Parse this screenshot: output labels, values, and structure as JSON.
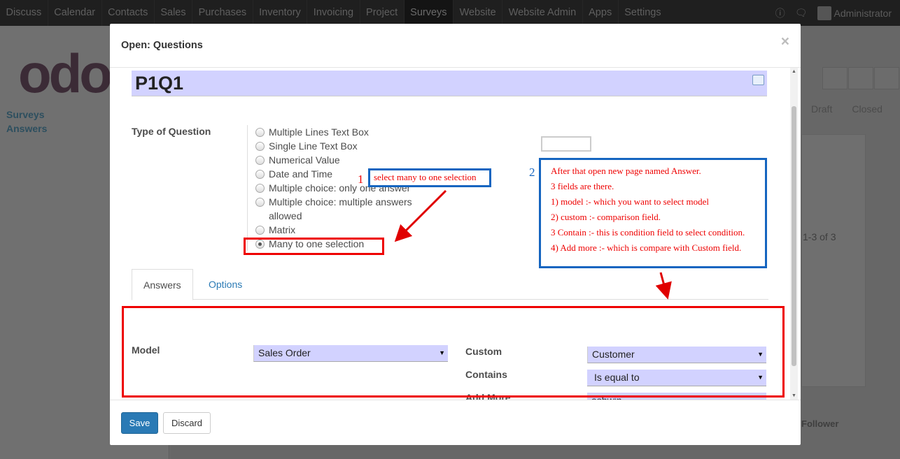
{
  "topbar": {
    "menu": [
      "Discuss",
      "Calendar",
      "Contacts",
      "Sales",
      "Purchases",
      "Inventory",
      "Invoicing",
      "Project",
      "Surveys",
      "Website",
      "Website Admin",
      "Apps",
      "Settings"
    ],
    "active": "Surveys",
    "user": "Administrator"
  },
  "background": {
    "logo": "odo",
    "sidebar_links": [
      "Surveys",
      "Answers"
    ],
    "status_steps": [
      "Draft",
      "Closed"
    ],
    "pager": "1-3 of 3",
    "follower_label": "Follower"
  },
  "modal": {
    "title": "Open: Questions",
    "close_label": "×",
    "question_name": "P1Q1",
    "type_label": "Type of Question",
    "question_types": [
      {
        "label": "Multiple Lines Text Box",
        "checked": false
      },
      {
        "label": "Single Line Text Box",
        "checked": false
      },
      {
        "label": "Numerical Value",
        "checked": false
      },
      {
        "label": "Date and Time",
        "checked": false
      },
      {
        "label": "Multiple choice: only one answer",
        "checked": false
      },
      {
        "label": "Multiple choice: multiple answers allowed",
        "checked": false
      },
      {
        "label": "Matrix",
        "checked": false
      },
      {
        "label": "Many to one selection",
        "checked": true
      }
    ],
    "tabs": [
      {
        "label": "Answers",
        "active": true
      },
      {
        "label": "Options",
        "active": false
      }
    ],
    "answers": {
      "model_label": "Model",
      "model_value": "Sales Order",
      "custom_label": "Custom",
      "custom_value": "Customer",
      "contains_label": "Contains",
      "contains_value": "Is equal to",
      "add_more_label": "Add More",
      "add_more_value": "ashwin"
    },
    "footer": {
      "save_label": "Save",
      "discard_label": "Discard"
    }
  },
  "annotations": {
    "num1": "1",
    "note1": "select many to one selection",
    "num2": "2",
    "note2_lines": [
      "After that open new page named Answer.",
      "3 fields are there.",
      "1) model :- which you want to select model",
      "2) custom :- comparison field.",
      "3  Contain  :- this is condition field to select condition.",
      "4) Add more :- which is compare with Custom field."
    ],
    "colors": {
      "red": "#e00000",
      "blue": "#1565c0"
    }
  }
}
